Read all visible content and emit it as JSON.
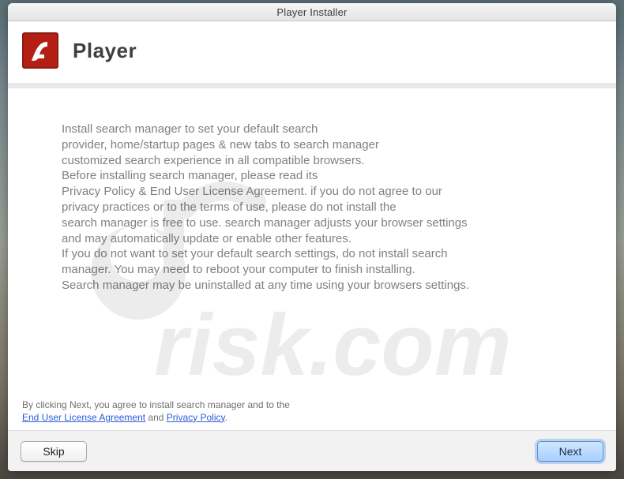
{
  "window": {
    "title": "Player Installer"
  },
  "header": {
    "app_name": "Player",
    "icon_name": "flash-player-icon"
  },
  "body": {
    "lines": [
      "Install search manager to set your default search",
      "provider, home/startup pages & new tabs to search manager",
      "customized search experience in all compatible browsers.",
      "Before installing search manager, please read its",
      "Privacy Policy & End User License Agreement. if you do not agree to our",
      "privacy practices or to the terms of use, please do not install the",
      "search manager is free to use. search manager adjusts your browser settings",
      "and may automatically update or enable other features.",
      "If you do not want to set your default search settings, do not install search",
      "manager. You may need to reboot your computer to finish installing.",
      "Search manager may be uninstalled at any time using your browsers settings."
    ]
  },
  "footer": {
    "prefix": "By clicking Next, you agree to install search manager and to the",
    "eula_label": "End User License Agreement",
    "and": " and ",
    "privacy_label": "Privacy Policy",
    "suffix": "."
  },
  "buttons": {
    "skip": "Skip",
    "next": "Next"
  },
  "watermark": {
    "text": "risk.com"
  }
}
